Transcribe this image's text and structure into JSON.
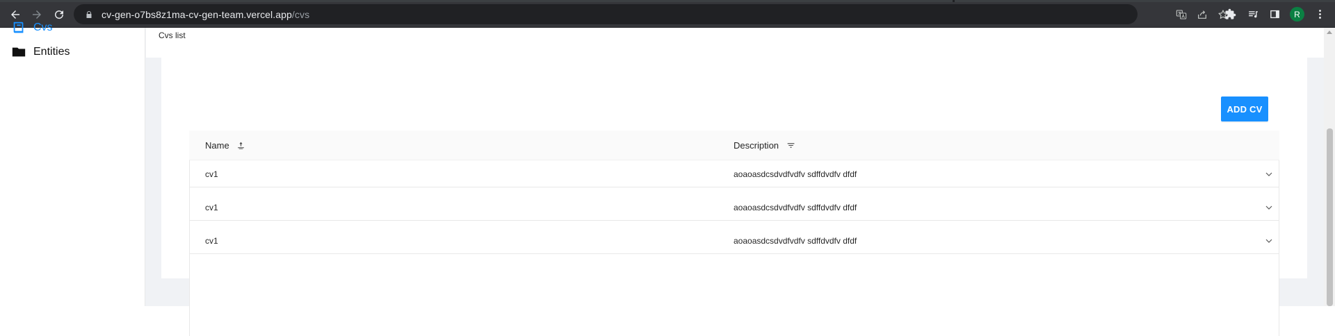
{
  "browser": {
    "url_host": "cv-gen-o7bs8z1ma-cv-gen-team.vercel.app",
    "url_path": "/cvs",
    "profile_initial": "R",
    "profile_color": "#0b8043",
    "icons": [
      "back-icon",
      "forward-icon",
      "reload-icon",
      "lock-icon",
      "translate-icon",
      "share-icon",
      "star-icon",
      "extensions-icon",
      "media-control-icon",
      "side-panel-icon",
      "profile-avatar",
      "more-icon"
    ]
  },
  "sidebar": {
    "items": [
      {
        "label": "Cvs",
        "icon": "book-icon",
        "active": true
      },
      {
        "label": "Entities",
        "icon": "folder-icon",
        "active": false
      }
    ]
  },
  "header": {
    "breadcrumb": "Cvs list"
  },
  "toolbar": {
    "add_label": "ADD CV",
    "accent": "#1890ff"
  },
  "table": {
    "columns": [
      {
        "label": "Name",
        "control": "sort-icon"
      },
      {
        "label": "Description",
        "control": "filter-icon"
      }
    ],
    "rows": [
      {
        "name": "cv1",
        "description": "aoaoasdcsdvdfvdfv sdffdvdfv dfdf"
      },
      {
        "name": "cv1",
        "description": "aoaoasdcsdvdfvdfv sdffdvdfv dfdf"
      },
      {
        "name": "cv1",
        "description": "aoaoasdcsdvdfvdfv sdffdvdfv dfdf"
      }
    ]
  }
}
